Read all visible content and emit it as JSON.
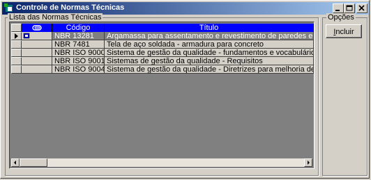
{
  "window": {
    "title": "Controle de Normas Técnicas"
  },
  "lista": {
    "label": "Lista das Normas Técnicas"
  },
  "opcoes": {
    "label": "Opções",
    "incluir_pre": "I",
    "incluir_rest": "ncluir"
  },
  "grid": {
    "headers": {
      "icon": "paperclip-icon",
      "codigo": "Código",
      "titulo": "Título"
    },
    "rows": [
      {
        "codigo": "NBR 13281",
        "titulo": "Argamassa para assentamento e revestimento de paredes e tetos - requisitos"
      },
      {
        "codigo": "NBR 7481",
        "titulo": "Tela de aço soldada - armadura para concreto"
      },
      {
        "codigo": "NBR ISO 9000",
        "titulo": "Sistema de gestão da qualidade - fundamentos e vocabulário"
      },
      {
        "codigo": "NBR ISO 9001",
        "titulo": "Sistemas de gestão da qualidade - Requisitos"
      },
      {
        "codigo": "NBR ISO 9004",
        "titulo": "Sistema de gestão da qualidade - Diretrizes para melhoria de desempenho"
      }
    ]
  },
  "colors": {
    "title_start": "#0a246a",
    "title_end": "#a6caf0",
    "header": "#0000ff",
    "face": "#d4d0c8"
  }
}
